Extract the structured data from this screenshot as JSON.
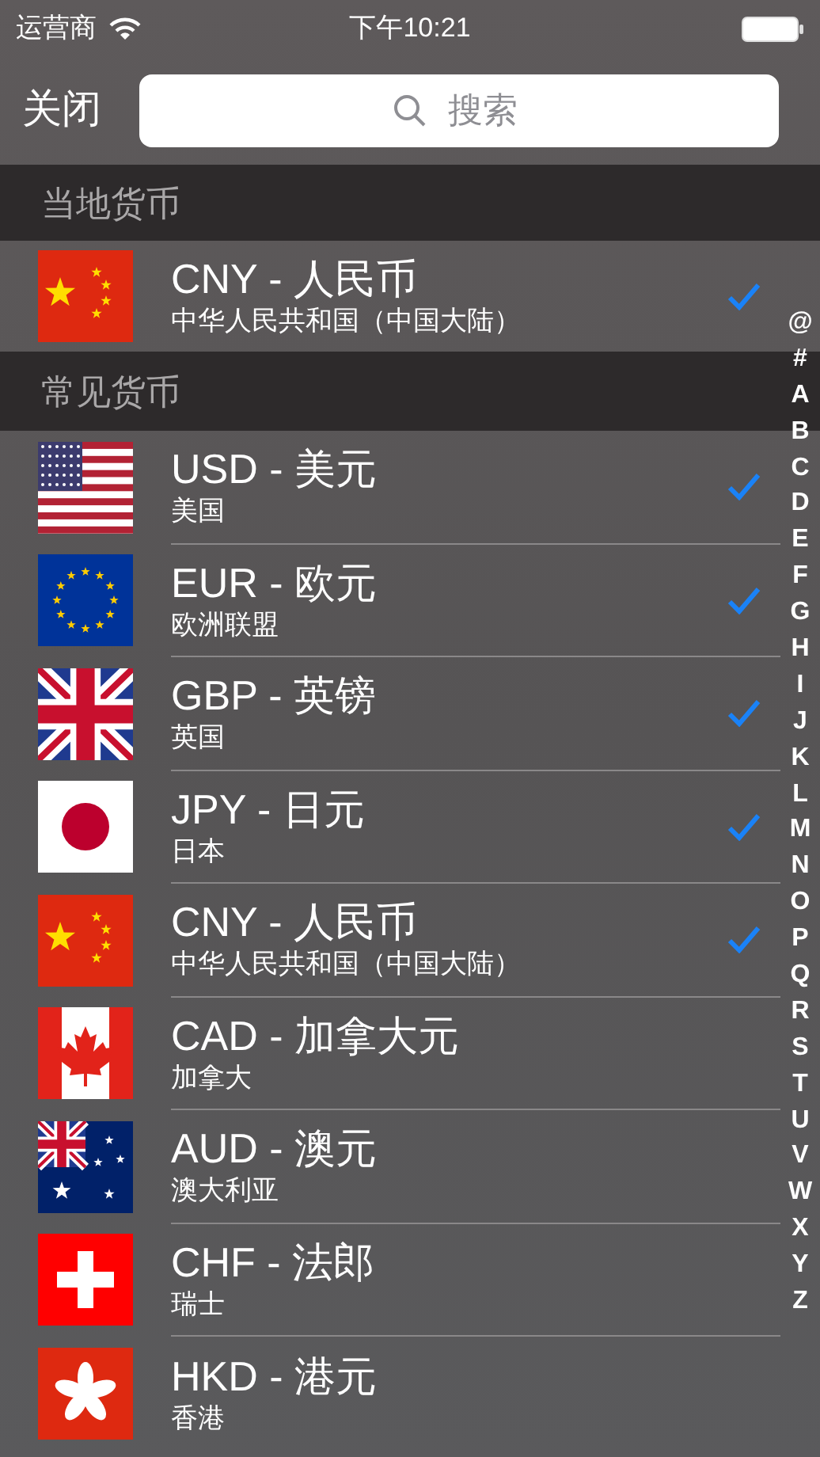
{
  "status_bar": {
    "carrier": "运营商",
    "time": "下午10:21"
  },
  "nav": {
    "close": "关闭",
    "search": {
      "placeholder": "搜索"
    }
  },
  "sections": [
    {
      "title": "当地货币",
      "rows": [
        {
          "kind": "cn",
          "name": "CNY - 人民币",
          "country": "中华人民共和国（中国大陆）",
          "checked": true
        }
      ]
    },
    {
      "title": "常见货币",
      "rows": [
        {
          "kind": "us",
          "name": "USD - 美元",
          "country": "美国",
          "checked": true
        },
        {
          "kind": "eu",
          "name": "EUR - 欧元",
          "country": "欧洲联盟",
          "checked": true
        },
        {
          "kind": "gb",
          "name": "GBP - 英镑",
          "country": "英国",
          "checked": true
        },
        {
          "kind": "jp",
          "name": "JPY - 日元",
          "country": "日本",
          "checked": true
        },
        {
          "kind": "cn",
          "name": "CNY - 人民币",
          "country": "中华人民共和国（中国大陆）",
          "checked": true
        },
        {
          "kind": "ca",
          "name": "CAD - 加拿大元",
          "country": "加拿大",
          "checked": false
        },
        {
          "kind": "au",
          "name": "AUD - 澳元",
          "country": "澳大利亚",
          "checked": false
        },
        {
          "kind": "ch",
          "name": "CHF - 法郎",
          "country": "瑞士",
          "checked": false
        },
        {
          "kind": "hk",
          "name": "HKD - 港元",
          "country": "香港",
          "checked": false
        }
      ]
    }
  ],
  "index": [
    "@",
    "#",
    "A",
    "B",
    "C",
    "D",
    "E",
    "F",
    "G",
    "H",
    "I",
    "J",
    "K",
    "L",
    "M",
    "N",
    "O",
    "P",
    "Q",
    "R",
    "S",
    "T",
    "U",
    "V",
    "W",
    "X",
    "Y",
    "Z"
  ]
}
